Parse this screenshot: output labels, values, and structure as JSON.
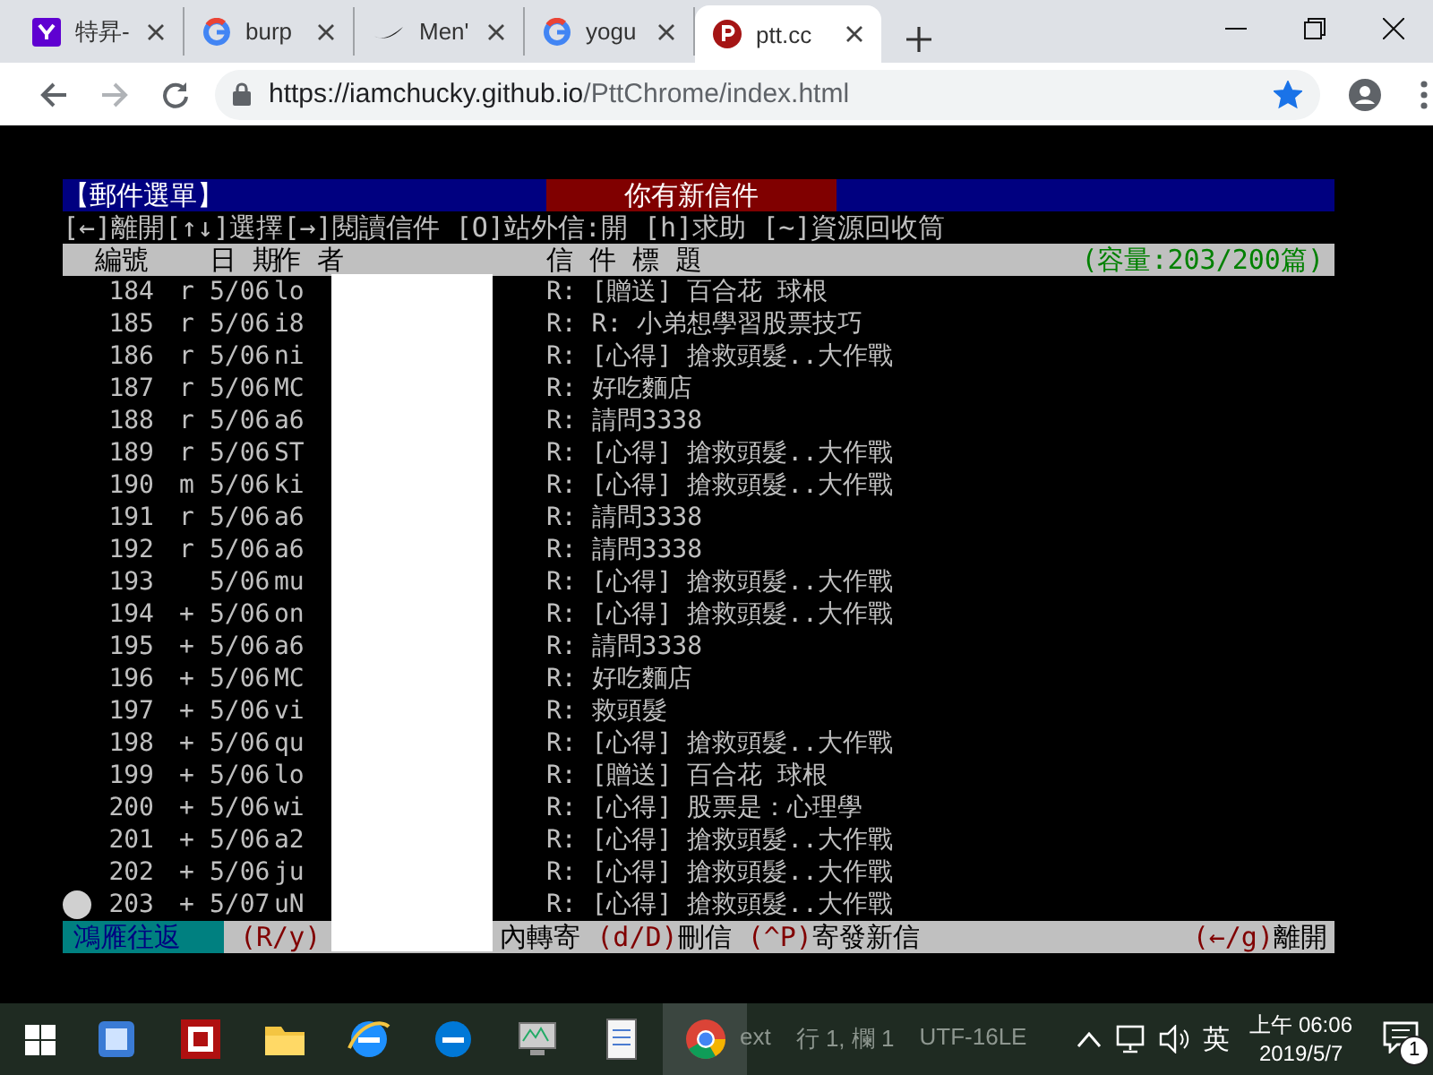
{
  "browser": {
    "tabs": [
      {
        "title": "特昇-",
        "selected": false
      },
      {
        "title": "burp",
        "selected": false
      },
      {
        "title": "Men'",
        "selected": false
      },
      {
        "title": "yogu",
        "selected": false
      },
      {
        "title": "ptt.cc",
        "selected": true
      }
    ],
    "url_host": "https://iamchucky.github.io",
    "url_path": "/PttChrome/index.html",
    "bookmarked": true
  },
  "terminal": {
    "menu_title": "【郵件選單】",
    "notice": "你有新信件",
    "help_line": "[←]離開[↑↓]選擇[→]閱讀信件 [O]站外信:開 [h]求助 [~]資源回收筒",
    "columns": [
      "編號",
      "日 期",
      "作 者",
      "信 件 標 題"
    ],
    "capacity": "(容量:203/200篇)",
    "rows": [
      {
        "number": "184",
        "mark": "r",
        "date": "5/06",
        "author": "lo",
        "title": "R: [贈送] 百合花 球根"
      },
      {
        "number": "185",
        "mark": "r",
        "date": "5/06",
        "author": "i8",
        "title": "R: R: 小弟想學習股票技巧"
      },
      {
        "number": "186",
        "mark": "r",
        "date": "5/06",
        "author": "ni",
        "title": "R: [心得] 搶救頭髮..大作戰"
      },
      {
        "number": "187",
        "mark": "r",
        "date": "5/06",
        "author": "MC",
        "title": "R: 好吃麵店"
      },
      {
        "number": "188",
        "mark": "r",
        "date": "5/06",
        "author": "a6",
        "title": "R: 請問3338"
      },
      {
        "number": "189",
        "mark": "r",
        "date": "5/06",
        "author": "ST",
        "title": "R: [心得] 搶救頭髮..大作戰"
      },
      {
        "number": "190",
        "mark": "m",
        "date": "5/06",
        "author": "ki",
        "title": "R: [心得] 搶救頭髮..大作戰"
      },
      {
        "number": "191",
        "mark": "r",
        "date": "5/06",
        "author": "a6",
        "title": "R: 請問3338"
      },
      {
        "number": "192",
        "mark": "r",
        "date": "5/06",
        "author": "a6",
        "title": "R: 請問3338"
      },
      {
        "number": "193",
        "date": "5/06",
        "author": "mu",
        "title": "R: [心得] 搶救頭髮..大作戰"
      },
      {
        "number": "194",
        "mark": "+",
        "date": "5/06",
        "author": "on",
        "title": "R: [心得] 搶救頭髮..大作戰"
      },
      {
        "number": "195",
        "mark": "+",
        "date": "5/06",
        "author": "a6",
        "title": "R: 請問3338"
      },
      {
        "number": "196",
        "mark": "+",
        "date": "5/06",
        "author": "MC",
        "title": "R: 好吃麵店"
      },
      {
        "number": "197",
        "mark": "+",
        "date": "5/06",
        "author": "vi",
        "title": "R: 救頭髮"
      },
      {
        "number": "198",
        "mark": "+",
        "date": "5/06",
        "author": "qu",
        "title": "R: [心得] 搶救頭髮..大作戰"
      },
      {
        "number": "199",
        "mark": "+",
        "date": "5/06",
        "author": "lo",
        "title": "R: [贈送] 百合花 球根"
      },
      {
        "number": "200",
        "mark": "+",
        "date": "5/06",
        "author": "wi",
        "title": "R: [心得] 股票是：心理學"
      },
      {
        "number": "201",
        "mark": "+",
        "date": "5/06",
        "author": "a2",
        "title": "R: [心得] 搶救頭髮..大作戰"
      },
      {
        "number": "202",
        "mark": "+",
        "date": "5/06",
        "author": "ju",
        "title": "R: [心得] 搶救頭髮..大作戰"
      },
      {
        "number": "203",
        "mark": "+",
        "date": "5/07",
        "author": "uN",
        "title": "R: [心得] 搶救頭髮..大作戰"
      }
    ],
    "footer": [
      {
        "kind": "title",
        "text": "鴻雁往返"
      },
      {
        "kind": "key",
        "text": "(R/y)"
      },
      {
        "kind": "text",
        "text": "內轉寄"
      },
      {
        "kind": "key",
        "text": "(d/D)"
      },
      {
        "kind": "text",
        "text": "刪信"
      },
      {
        "kind": "key",
        "text": "(^P)"
      },
      {
        "kind": "text",
        "text": "寄發新信"
      }
    ],
    "footer_right": [
      {
        "kind": "key",
        "text": "(←/g)"
      },
      {
        "kind": "text",
        "text": "離開"
      }
    ]
  },
  "taskbar": {
    "behind_status": [
      "ext",
      "行 1, 欄 1",
      "UTF-16LE"
    ],
    "input_method": "英",
    "time": "上午 06:06",
    "date": "2019/5/7",
    "notifications": "1"
  }
}
